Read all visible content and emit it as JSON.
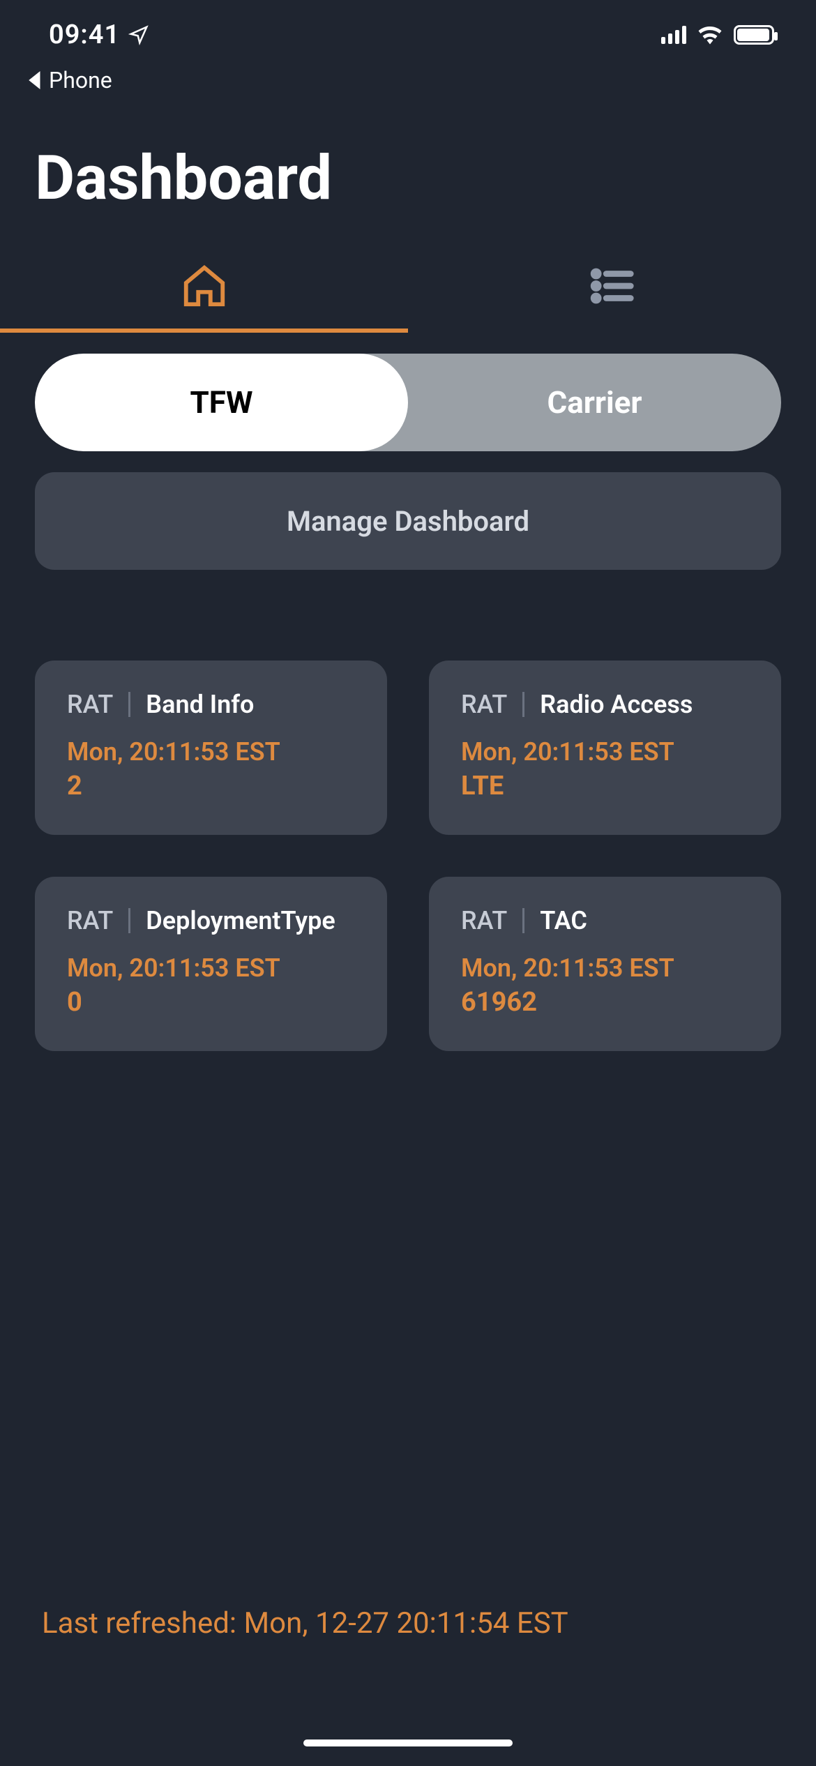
{
  "status_bar": {
    "time": "09:41",
    "back_app": "Phone"
  },
  "page": {
    "title": "Dashboard"
  },
  "segmented": {
    "options": [
      "TFW",
      "Carrier"
    ],
    "active_index": 0
  },
  "manage_button": "Manage Dashboard",
  "cards": [
    {
      "category": "RAT",
      "title": "Band Info",
      "timestamp": "Mon, 20:11:53 EST",
      "value": "2"
    },
    {
      "category": "RAT",
      "title": "Radio Access",
      "timestamp": "Mon, 20:11:53 EST",
      "value": "LTE"
    },
    {
      "category": "RAT",
      "title": "DeploymentType",
      "timestamp": "Mon, 20:11:53 EST",
      "value": "0"
    },
    {
      "category": "RAT",
      "title": "TAC",
      "timestamp": "Mon, 20:11:53 EST",
      "value": "61962"
    }
  ],
  "footer": {
    "last_refreshed_label": "Last refreshed: ",
    "last_refreshed_value": "Mon, 12-27 20:11:54 EST"
  },
  "colors": {
    "accent": "#de8a3f",
    "bg": "#1f2530",
    "card": "#3e4450"
  }
}
